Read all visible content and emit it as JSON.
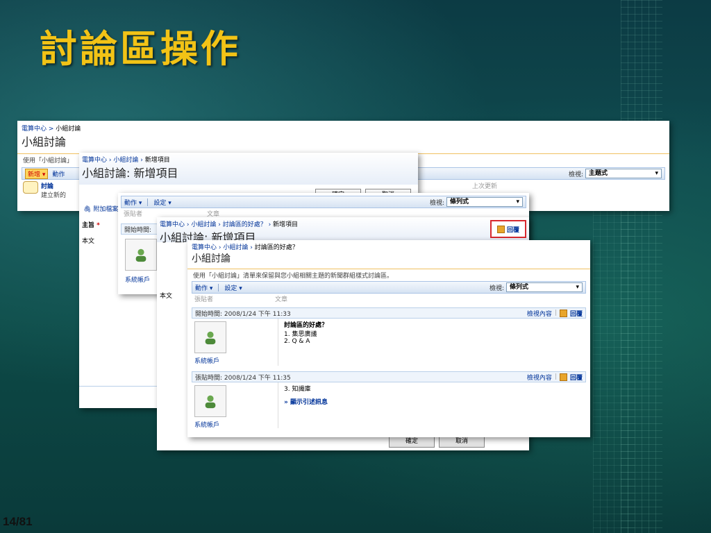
{
  "slide": {
    "title": "討論區操作",
    "page": "14/81"
  },
  "w1": {
    "crumb_a": "電算中心",
    "crumb_sep": " > ",
    "crumb_b": "小組討論",
    "title": "小組討論",
    "desc": "使用「小組討論」",
    "new_btn": "新增",
    "action": "動作",
    "item_title": "討論",
    "item_desc": "建立新的",
    "view_label": "檢視:",
    "view_value": "主題式",
    "col_last": "上次更新"
  },
  "w2": {
    "crumb_a": "電算中心",
    "crumb_b": "小組討論",
    "crumb_c": "新增項目",
    "title": "小組討論: 新增項目",
    "attach": "附加檔案",
    "subject": "主旨",
    "required": "*",
    "body": "本文",
    "ok": "確定",
    "cancel": "取消"
  },
  "w3": {
    "action": "動作",
    "settings": "設定",
    "view_label": "檢視:",
    "view_value": "條列式",
    "col_author": "張貼者",
    "col_post": "文章",
    "started": "開始時間:",
    "user": "系統帳戶",
    "attach": "附加"
  },
  "w4": {
    "crumb_a": "電算中心",
    "crumb_b": "小組討論",
    "crumb_c": "討論區的好處？",
    "crumb_d": "新增項目",
    "title": "小組討論: 新增項目",
    "reply": "回覆",
    "body": "本文",
    "ok": "確定",
    "cancel": "取消"
  },
  "w5": {
    "crumb_a": "電算中心",
    "crumb_b": "小組討論",
    "crumb_c": "討論區的好處？",
    "title": "小組討論",
    "desc": "使用「小組討論」清單來保留與您小組相關主題的新聞群組樣式討論區。",
    "action": "動作",
    "settings": "設定",
    "view_label": "檢視:",
    "view_value": "條列式",
    "col_author": "張貼者",
    "col_post": "文章",
    "posts": [
      {
        "time": "開始時間: 2008/1/24 下午 11:33",
        "view": "檢視內容",
        "reply": "回覆",
        "user": "系統帳戶",
        "subject": "討論區的好處？",
        "lines": [
          "1. 集思廣議",
          "2. Q & A"
        ]
      },
      {
        "time": "張貼時間: 2008/1/24 下午 11:35",
        "view": "檢視內容",
        "reply": "回覆",
        "user": "系統帳戶",
        "subject": "",
        "lines": [
          "3. 知識庫"
        ],
        "quote": "顯示引述訊息"
      }
    ]
  }
}
